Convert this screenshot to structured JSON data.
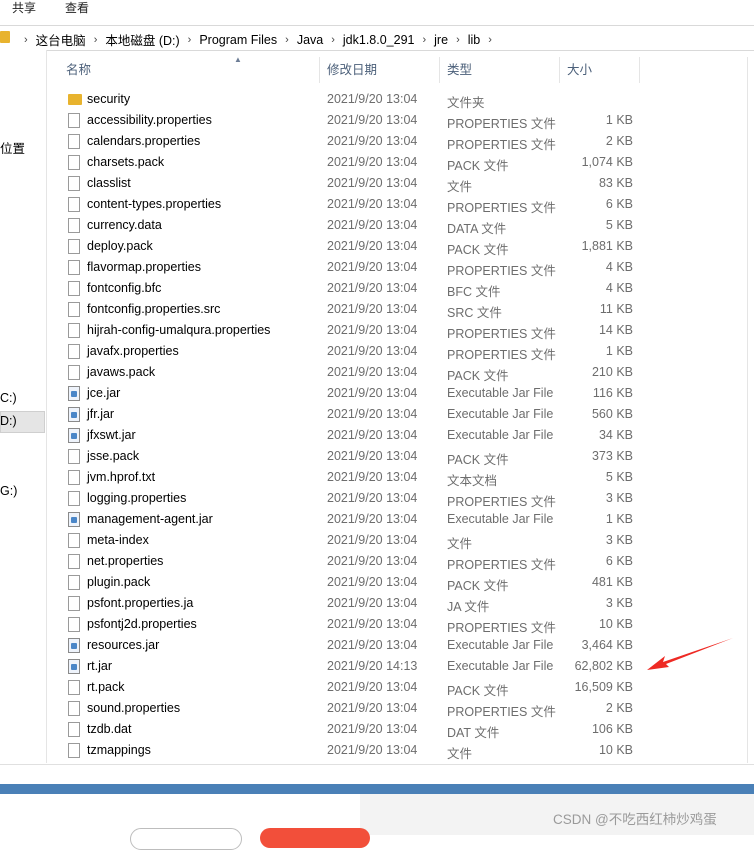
{
  "ribbon": {
    "tabs": [
      "共享",
      "查看"
    ]
  },
  "address": {
    "crumbs": [
      "这台电脑",
      "本地磁盘 (D:)",
      "Program Files",
      "Java",
      "jdk1.8.0_291",
      "jre",
      "lib"
    ]
  },
  "navpane": {
    "items": [
      {
        "label": "位置"
      },
      {
        "label": "C:)"
      },
      {
        "label": "D:)"
      },
      {
        "label": "G:)"
      }
    ]
  },
  "columns": {
    "name": "名称",
    "date": "修改日期",
    "type": "类型",
    "size": "大小"
  },
  "files": [
    {
      "icon": "folder-icon",
      "name": "security",
      "date": "2021/9/20 13:04",
      "type": "文件夹",
      "size": ""
    },
    {
      "icon": "file-icon",
      "name": "accessibility.properties",
      "date": "2021/9/20 13:04",
      "type": "PROPERTIES 文件",
      "size": "1 KB"
    },
    {
      "icon": "file-icon",
      "name": "calendars.properties",
      "date": "2021/9/20 13:04",
      "type": "PROPERTIES 文件",
      "size": "2 KB"
    },
    {
      "icon": "file-icon",
      "name": "charsets.pack",
      "date": "2021/9/20 13:04",
      "type": "PACK 文件",
      "size": "1,074 KB"
    },
    {
      "icon": "file-icon",
      "name": "classlist",
      "date": "2021/9/20 13:04",
      "type": "文件",
      "size": "83 KB"
    },
    {
      "icon": "file-icon",
      "name": "content-types.properties",
      "date": "2021/9/20 13:04",
      "type": "PROPERTIES 文件",
      "size": "6 KB"
    },
    {
      "icon": "file-icon",
      "name": "currency.data",
      "date": "2021/9/20 13:04",
      "type": "DATA 文件",
      "size": "5 KB"
    },
    {
      "icon": "file-icon",
      "name": "deploy.pack",
      "date": "2021/9/20 13:04",
      "type": "PACK 文件",
      "size": "1,881 KB"
    },
    {
      "icon": "file-icon",
      "name": "flavormap.properties",
      "date": "2021/9/20 13:04",
      "type": "PROPERTIES 文件",
      "size": "4 KB"
    },
    {
      "icon": "file-icon",
      "name": "fontconfig.bfc",
      "date": "2021/9/20 13:04",
      "type": "BFC 文件",
      "size": "4 KB"
    },
    {
      "icon": "file-icon",
      "name": "fontconfig.properties.src",
      "date": "2021/9/20 13:04",
      "type": "SRC 文件",
      "size": "11 KB"
    },
    {
      "icon": "file-icon",
      "name": "hijrah-config-umalqura.properties",
      "date": "2021/9/20 13:04",
      "type": "PROPERTIES 文件",
      "size": "14 KB"
    },
    {
      "icon": "file-icon",
      "name": "javafx.properties",
      "date": "2021/9/20 13:04",
      "type": "PROPERTIES 文件",
      "size": "1 KB"
    },
    {
      "icon": "file-icon",
      "name": "javaws.pack",
      "date": "2021/9/20 13:04",
      "type": "PACK 文件",
      "size": "210 KB"
    },
    {
      "icon": "jar-icon",
      "name": "jce.jar",
      "date": "2021/9/20 13:04",
      "type": "Executable Jar File",
      "size": "116 KB"
    },
    {
      "icon": "jar-icon",
      "name": "jfr.jar",
      "date": "2021/9/20 13:04",
      "type": "Executable Jar File",
      "size": "560 KB"
    },
    {
      "icon": "jar-icon",
      "name": "jfxswt.jar",
      "date": "2021/9/20 13:04",
      "type": "Executable Jar File",
      "size": "34 KB"
    },
    {
      "icon": "file-icon",
      "name": "jsse.pack",
      "date": "2021/9/20 13:04",
      "type": "PACK 文件",
      "size": "373 KB"
    },
    {
      "icon": "file-icon",
      "name": "jvm.hprof.txt",
      "date": "2021/9/20 13:04",
      "type": "文本文档",
      "size": "5 KB"
    },
    {
      "icon": "file-icon",
      "name": "logging.properties",
      "date": "2021/9/20 13:04",
      "type": "PROPERTIES 文件",
      "size": "3 KB"
    },
    {
      "icon": "jar-icon",
      "name": "management-agent.jar",
      "date": "2021/9/20 13:04",
      "type": "Executable Jar File",
      "size": "1 KB"
    },
    {
      "icon": "file-icon",
      "name": "meta-index",
      "date": "2021/9/20 13:04",
      "type": "文件",
      "size": "3 KB"
    },
    {
      "icon": "file-icon",
      "name": "net.properties",
      "date": "2021/9/20 13:04",
      "type": "PROPERTIES 文件",
      "size": "6 KB"
    },
    {
      "icon": "file-icon",
      "name": "plugin.pack",
      "date": "2021/9/20 13:04",
      "type": "PACK 文件",
      "size": "481 KB"
    },
    {
      "icon": "file-icon",
      "name": "psfont.properties.ja",
      "date": "2021/9/20 13:04",
      "type": "JA 文件",
      "size": "3 KB"
    },
    {
      "icon": "file-icon",
      "name": "psfontj2d.properties",
      "date": "2021/9/20 13:04",
      "type": "PROPERTIES 文件",
      "size": "10 KB"
    },
    {
      "icon": "jar-icon",
      "name": "resources.jar",
      "date": "2021/9/20 13:04",
      "type": "Executable Jar File",
      "size": "3,464 KB"
    },
    {
      "icon": "jar-icon",
      "name": "rt.jar",
      "date": "2021/9/20 14:13",
      "type": "Executable Jar File",
      "size": "62,802 KB"
    },
    {
      "icon": "file-icon",
      "name": "rt.pack",
      "date": "2021/9/20 13:04",
      "type": "PACK 文件",
      "size": "16,509 KB"
    },
    {
      "icon": "file-icon",
      "name": "sound.properties",
      "date": "2021/9/20 13:04",
      "type": "PROPERTIES 文件",
      "size": "2 KB"
    },
    {
      "icon": "file-icon",
      "name": "tzdb.dat",
      "date": "2021/9/20 13:04",
      "type": "DAT 文件",
      "size": "106 KB"
    },
    {
      "icon": "file-icon",
      "name": "tzmappings",
      "date": "2021/9/20 13:04",
      "type": "文件",
      "size": "10 KB"
    }
  ],
  "watermark": "CSDN @不吃西红柿炒鸡蛋",
  "colors": {
    "arrow": "#ee2a24",
    "folder": "#e8b32e",
    "header_text": "#4c607a",
    "accent_band": "#4a80b7"
  }
}
